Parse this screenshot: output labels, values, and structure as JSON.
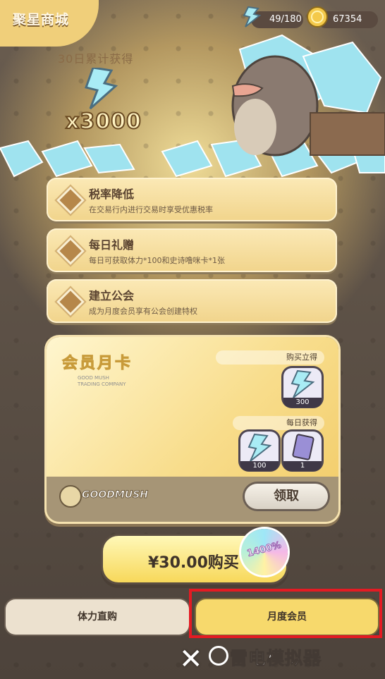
{
  "header": {
    "title": "聚星商城",
    "energy": "49/180",
    "coins": "67354"
  },
  "promo": {
    "label": "30日累计获得",
    "count": "x3000"
  },
  "perks": [
    {
      "title": "税率降低",
      "desc": "在交易行内进行交易时享受优惠税率"
    },
    {
      "title": "每日礼赠",
      "desc": "每日可获取体力*100和史诗噜咪卡*1张"
    },
    {
      "title": "建立公会",
      "desc": "成为月度会员享有公会创建特权"
    }
  ],
  "card": {
    "title": "会员月卡",
    "subtitle_line1": "GOOD MUSH",
    "subtitle_line2": "TRADING COMPANY",
    "brand": "GOODMUSH",
    "instant_label": "购买立得",
    "instant_item_count": "300",
    "daily_label": "每日获得",
    "daily_items": [
      "100",
      "1"
    ],
    "claim_label": "领取"
  },
  "purchase": {
    "label": "¥30.00购买",
    "badge": "1400%"
  },
  "tabs": [
    {
      "label": "体力直购"
    },
    {
      "label": "月度会员"
    }
  ],
  "watermark": "雷电模拟器",
  "colors": {
    "highlight_border": "#e41b23",
    "active_tab": "#f7d96c",
    "inactive_tab": "#ece1cf"
  },
  "icons": {
    "energy": "lightning-crystal-icon",
    "coin": "gold-coin-icon",
    "close": "close-icon"
  }
}
